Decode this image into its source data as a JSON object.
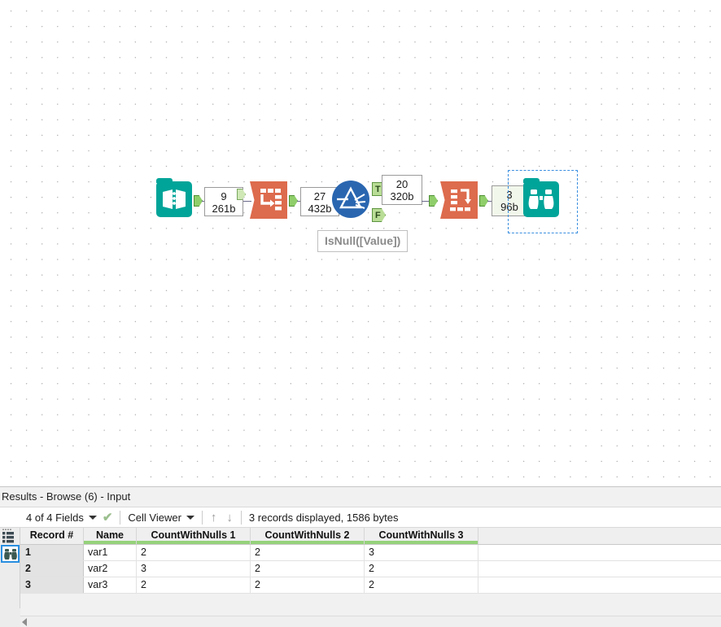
{
  "canvas": {
    "tools": [
      {
        "id": "input-data",
        "name": "Input Data",
        "icon": "open-book-icon",
        "color": "#00a499"
      },
      {
        "id": "transpose",
        "name": "Transpose",
        "icon": "transpose-icon",
        "color": "#dd6b4d"
      },
      {
        "id": "filter",
        "name": "Filter",
        "icon": "filter-prism-icon",
        "color": "#2a66b0"
      },
      {
        "id": "cross-tab",
        "name": "Cross Tab",
        "icon": "cross-tab-icon",
        "color": "#dd6b4d"
      },
      {
        "id": "browse",
        "name": "Browse",
        "icon": "binoculars-icon",
        "color": "#00a499"
      }
    ],
    "connections": [
      {
        "id": "conn-1",
        "records": "9",
        "size": "261b"
      },
      {
        "id": "conn-2",
        "records": "27",
        "size": "432b"
      },
      {
        "id": "conn-3",
        "records": "20",
        "size": "320b"
      },
      {
        "id": "conn-4",
        "records": "3",
        "size": "96b"
      }
    ],
    "filter_outputs": {
      "true_label": "T",
      "false_label": "F"
    },
    "expression_label": "IsNull([Value])",
    "selected_tool": "browse"
  },
  "results": {
    "title": "Results - Browse (6) - Input",
    "toolbar": {
      "fields_label": "4 of 4 Fields",
      "viewer_label": "Cell Viewer",
      "arrow_up": "↑",
      "arrow_down": "↓",
      "status": "3 records displayed, 1586 bytes",
      "check_glyph": "✔"
    },
    "table": {
      "columns": [
        "Record #",
        "Name",
        "CountWithNulls 1",
        "CountWithNulls 2",
        "CountWithNulls 3"
      ],
      "rows": [
        {
          "record": "1",
          "name": "var1",
          "n1": "2",
          "n2": "2",
          "n3": "3"
        },
        {
          "record": "2",
          "name": "var2",
          "n1": "3",
          "n2": "2",
          "n3": "2"
        },
        {
          "record": "3",
          "name": "var3",
          "n1": "2",
          "n2": "2",
          "n3": "2"
        }
      ]
    }
  }
}
